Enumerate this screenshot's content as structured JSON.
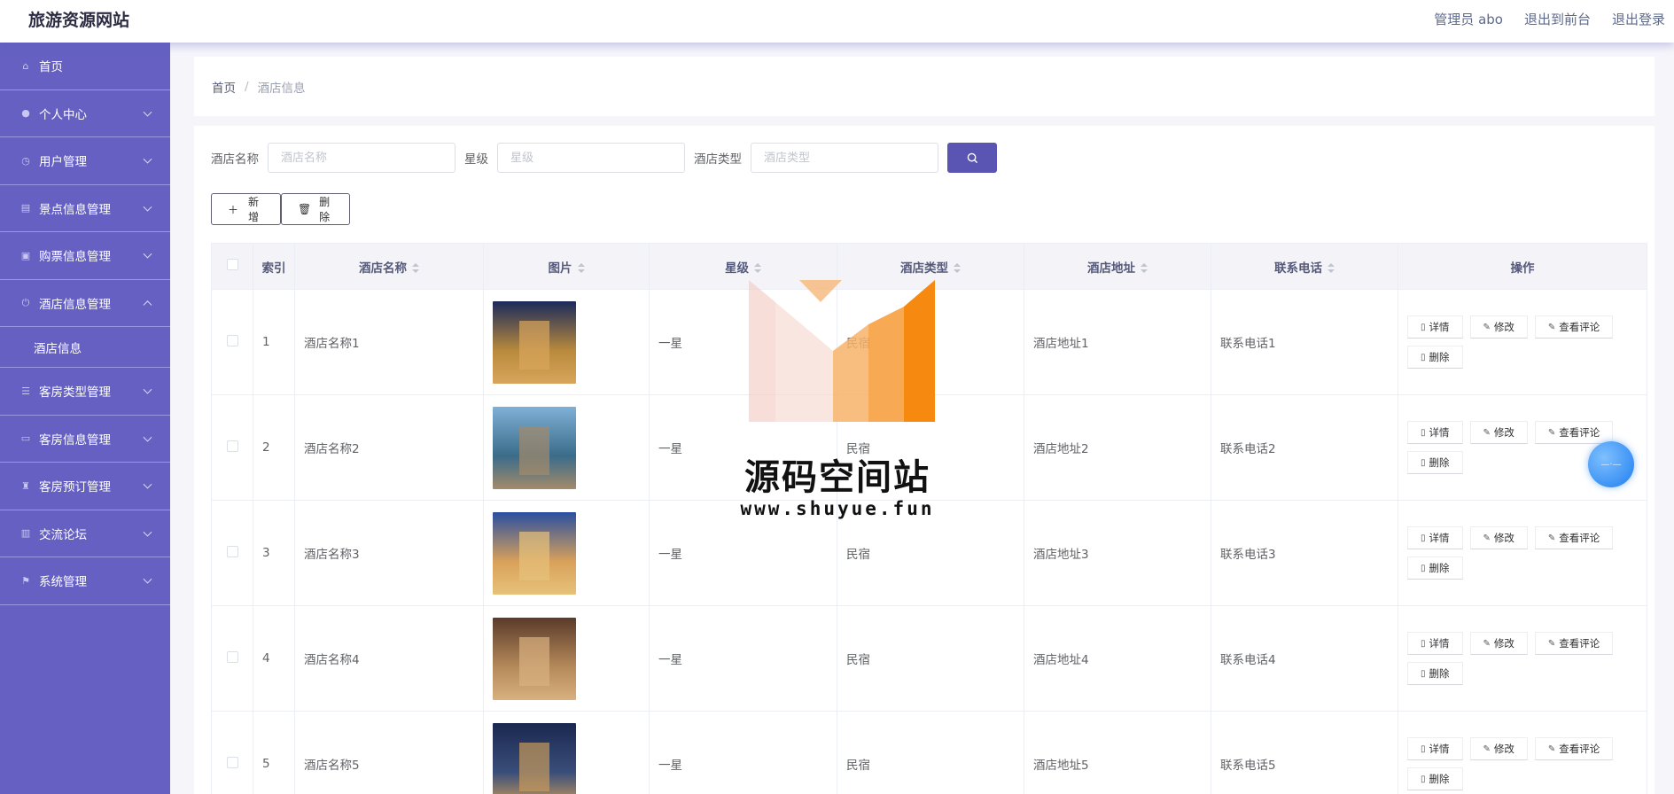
{
  "app": {
    "title": "旅游资源网站"
  },
  "topbar": {
    "user_label": "管理员 abo",
    "to_front": "退出到前台",
    "logout": "退出登录"
  },
  "sidebar": {
    "items": [
      {
        "label": "首页"
      },
      {
        "label": "个人中心"
      },
      {
        "label": "用户管理"
      },
      {
        "label": "景点信息管理"
      },
      {
        "label": "购票信息管理"
      },
      {
        "label": "酒店信息管理",
        "sub": "酒店信息"
      },
      {
        "label": "客房类型管理"
      },
      {
        "label": "客房信息管理"
      },
      {
        "label": "客房预订管理"
      },
      {
        "label": "交流论坛"
      },
      {
        "label": "系统管理"
      }
    ]
  },
  "breadcrumb": {
    "home": "首页",
    "sep": "/",
    "current": "酒店信息"
  },
  "search": {
    "name_label": "酒店名称",
    "name_placeholder": "酒店名称",
    "star_label": "星级",
    "star_placeholder": "星级",
    "type_label": "酒店类型",
    "type_placeholder": "酒店类型"
  },
  "actions": {
    "add": "新增",
    "delete": "删除"
  },
  "table": {
    "headers": {
      "index": "索引",
      "name": "酒店名称",
      "image": "图片",
      "star": "星级",
      "type": "酒店类型",
      "address": "酒店地址",
      "phone": "联系电话",
      "ops": "操作"
    },
    "op_labels": {
      "detail": "详情",
      "edit": "修改",
      "comments": "查看评论",
      "delete": "删除"
    },
    "rows": [
      {
        "index": "1",
        "name": "酒店名称1",
        "star": "一星",
        "type": "民宿",
        "address": "酒店地址1",
        "phone": "联系电话1"
      },
      {
        "index": "2",
        "name": "酒店名称2",
        "star": "一星",
        "type": "民宿",
        "address": "酒店地址2",
        "phone": "联系电话2"
      },
      {
        "index": "3",
        "name": "酒店名称3",
        "star": "一星",
        "type": "民宿",
        "address": "酒店地址3",
        "phone": "联系电话3"
      },
      {
        "index": "4",
        "name": "酒店名称4",
        "star": "一星",
        "type": "民宿",
        "address": "酒店地址4",
        "phone": "联系电话4"
      },
      {
        "index": "5",
        "name": "酒店名称5",
        "star": "一星",
        "type": "民宿",
        "address": "酒店地址5",
        "phone": "联系电话5"
      }
    ]
  },
  "watermark": {
    "title": "源码空间站",
    "url": "www.shuyue.fun"
  },
  "colors": {
    "sidebar": "#6560c2",
    "accent": "#5a55b2"
  }
}
